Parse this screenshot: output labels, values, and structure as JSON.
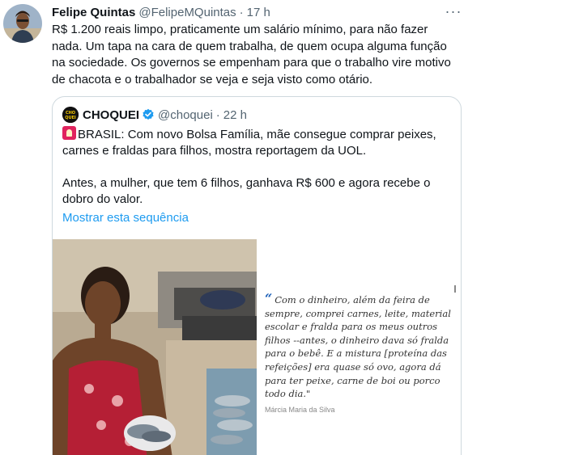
{
  "tweet": {
    "author_name": "Felipe Quintas",
    "handle": "@FelipeMQuintas",
    "separator": "·",
    "time": "17 h",
    "more_glyph": "···",
    "text": "R$ 1.200 reais limpo, praticamente um salário mínimo, para não fazer nada. Um tapa na cara de quem trabalha, de quem ocupa alguma função na sociedade. Os governos se empenham para que o trabalho vire motivo de chacota e o trabalhador se veja e seja visto como otário."
  },
  "quote": {
    "name": "CHOQUEI",
    "handle": "@choquei",
    "separator": "·",
    "time": "22 h",
    "logo_text": "CHO QUEI",
    "para1": "BRASIL: Com novo Bolsa Família, mãe consegue comprar peixes, carnes e fraldas para filhos, mostra reportagem da UOL.",
    "para2": "Antes, a mulher, que tem 6 filhos, ganhava R$ 600 e agora recebe o dobro do valor.",
    "show_more": "Mostrar esta sequência",
    "media": {
      "quote_mark": "“",
      "caption": "Com o dinheiro, além da feira de sempre, comprei carnes, leite, material escolar e fralda para os meus outros filhos --antes, o dinheiro dava só fralda para o bebê. E a mistura [proteína das refeições] era quase só ovo, agora dá para ter peixe, carne de boi ou porco todo dia.\"",
      "attribution": "Márcia Maria da Silva"
    }
  },
  "colors": {
    "text": "#0f1419",
    "secondary": "#536471",
    "link": "#1d9bf0",
    "border": "#cfd9de",
    "verified": "#1d9bf0"
  }
}
